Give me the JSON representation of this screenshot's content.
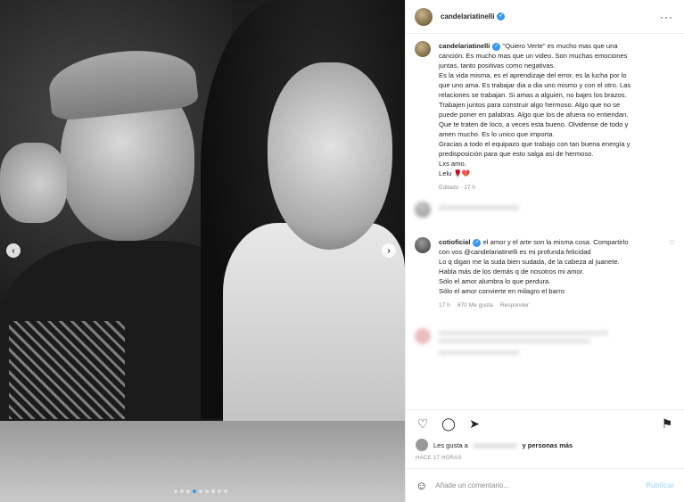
{
  "post": {
    "username": "candelariatinelli",
    "more_icon": "more-horizontal-icon"
  },
  "photo": {
    "nav_left": "‹",
    "nav_right": "›",
    "dots": [
      false,
      false,
      false,
      true,
      false,
      false,
      false,
      false,
      false
    ]
  },
  "caption": {
    "username": "candelariatinelli",
    "lines": [
      "\"Quiero Verte\" es mucho mas que una",
      "canción. Es mucho mas que un video. Son muchas emociones",
      "juntas, tanto positivas como negativas.",
      "Es la vida misma, es el aprendizaje del error, es la lucha por lo",
      "que uno ama. Es trabajar dia a dia uno mismo y con el otro. Las",
      "relaciones se trabajan. Si amas a alguien, no bajes los brazos.",
      "Trabajen juntos para construir algo hermoso. Algo que no se",
      "puede poner en palabras. Algo que los de afuera no entiendan.",
      "Que te traten de loco, a veces esta bueno. Olvidense de todo y",
      "amen mucho. Es lo unico que importa.",
      "Gracias a todo el equipazo que trabajo con tan buena energía y",
      "predisposición para que esto salga asi de hermoso.",
      "Lxs amo.",
      "Lelu 🌹💔"
    ],
    "meta": "Editado · 17 h"
  },
  "comment_cotio": {
    "username": "cotioficial",
    "lines": [
      "el amor y el arte son la misma cosa. Compartirlo",
      "con vos @candelariatinelli es mi profunda felicidad",
      "Lo q digan me la suda bien sudada, de la cabeza al juanete.",
      "Habla más de los demás q de nosotros mi amor.",
      "Sólo el amor alumbra lo que perdura.",
      "Sólo el amor convierte en milagro el barro"
    ],
    "time": "17 h",
    "likes": "670 Me gusta",
    "reply": "Responder"
  },
  "likes_bar": {
    "prefix": "Les gusta a",
    "suffix": "y personas más"
  },
  "time_ago": "HACE 17 HORAS",
  "add_comment": {
    "placeholder": "Añade un comentario...",
    "publish": "Publicar"
  }
}
